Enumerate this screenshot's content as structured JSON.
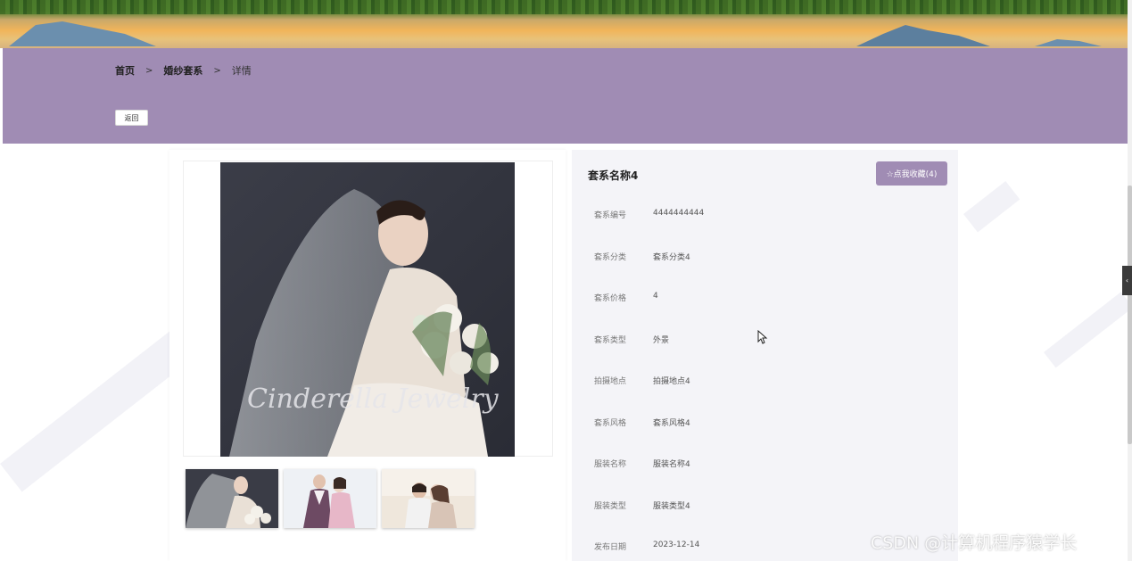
{
  "breadcrumb": {
    "home": "首页",
    "category": "婚纱套系",
    "current": "详情",
    "separator": ">"
  },
  "back_button": "返回",
  "detail": {
    "title": "套系名称4",
    "favorite_button": "☆点我收藏(4)",
    "fields": [
      {
        "label": "套系编号",
        "value": "4444444444"
      },
      {
        "label": "套系分类",
        "value": "套系分类4"
      },
      {
        "label": "套系价格",
        "value": "4"
      },
      {
        "label": "套系类型",
        "value": "外景"
      },
      {
        "label": "拍摄地点",
        "value": "拍摄地点4"
      },
      {
        "label": "套系风格",
        "value": "套系风格4"
      },
      {
        "label": "服装名称",
        "value": "服装名称4"
      },
      {
        "label": "服装类型",
        "value": "服装类型4"
      },
      {
        "label": "发布日期",
        "value": "2023-12-14"
      }
    ]
  },
  "gallery": {
    "main_image_caption": "Cinderella Jewelry"
  },
  "side_tab": "‹",
  "watermark": "CSDN @计算机程序猿学长",
  "colors": {
    "accent": "#a08cb4",
    "panel": "#f4f4f8"
  }
}
